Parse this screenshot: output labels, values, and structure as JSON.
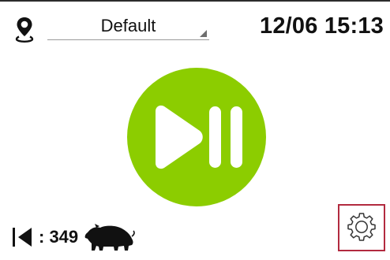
{
  "header": {
    "profile_value": "Default",
    "datetime": "12/06 15:13"
  },
  "main": {
    "play_pause": {
      "icon": "play-pause-icon",
      "color": "#8ccd00"
    }
  },
  "footer": {
    "counter_label": ": 349",
    "counter_icon": "pig-icon",
    "settings_icon": "gear-icon",
    "settings_highlight_color": "#b22a3f"
  }
}
